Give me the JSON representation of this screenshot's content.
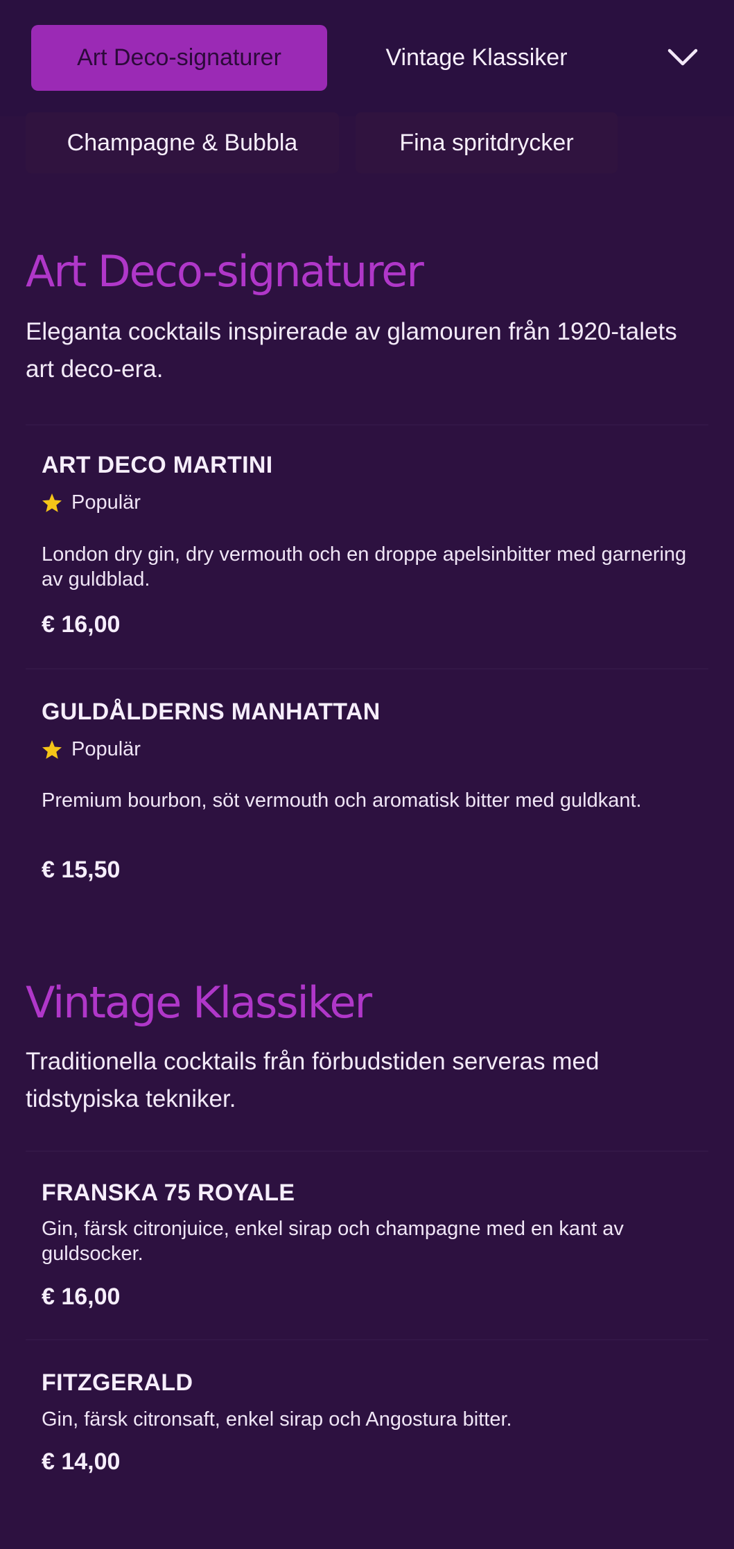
{
  "nav": {
    "categories": [
      {
        "label": "Art Deco-signaturer",
        "active": true
      },
      {
        "label": "Vintage Klassiker",
        "active": false
      },
      {
        "label": "Champagne & Bubbla",
        "active": false
      },
      {
        "label": "Fina spritdrycker",
        "active": false
      }
    ],
    "dropdown_icon": "chevron-down-icon"
  },
  "colors": {
    "background": "#2d1140",
    "accent": "#9b2ab5",
    "heading": "#b037c9",
    "star": "#f5c518"
  },
  "sections": [
    {
      "title": "Art Deco-signaturer",
      "description": "Eleganta cocktails inspirerade av glamouren från 1920-talets art deco-era.",
      "items": [
        {
          "name": "ART DECO MARTINI",
          "badge": "Populär",
          "description": "London dry gin, dry vermouth och en droppe apelsinbitter med garnering av guldblad.",
          "price": "€ 16,00"
        },
        {
          "name": "GULDÅLDERNS MANHATTAN",
          "badge": "Populär",
          "description": "Premium bourbon, söt vermouth och aromatisk bitter med guldkant.",
          "price": "€ 15,50"
        }
      ]
    },
    {
      "title": "Vintage Klassiker",
      "description": "Traditionella cocktails från förbudstiden serveras med tidstypiska tekniker.",
      "items": [
        {
          "name": "FRANSKA 75 ROYALE",
          "description": "Gin, färsk citronjuice, enkel sirap och champagne med en kant av guldsocker.",
          "price": "€ 16,00"
        },
        {
          "name": "FITZGERALD",
          "description": "Gin, färsk citronsaft, enkel sirap och Angostura bitter.",
          "price": "€ 14,00"
        }
      ]
    }
  ]
}
